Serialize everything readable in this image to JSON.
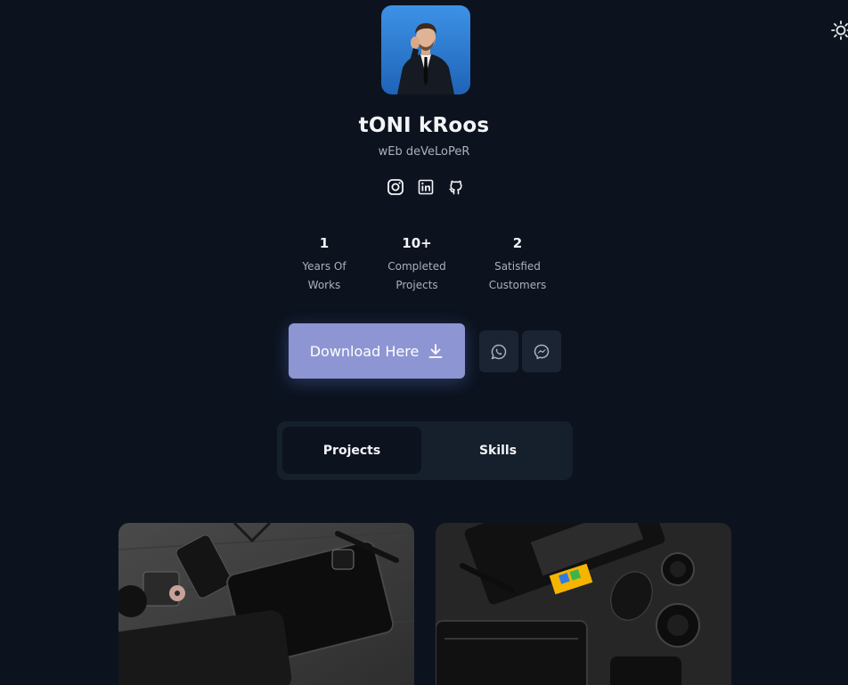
{
  "profile": {
    "name": "tONI kRoos",
    "role": "wEb deVeLoPeR"
  },
  "socials": [
    {
      "icon": "instagram-icon"
    },
    {
      "icon": "linkedin-icon"
    },
    {
      "icon": "github-icon"
    }
  ],
  "stats": [
    {
      "value": "1",
      "label_line1": "Years Of",
      "label_line2": "Works"
    },
    {
      "value": "10+",
      "label_line1": "Completed",
      "label_line2": "Projects"
    },
    {
      "value": "2",
      "label_line1": "Satisfied",
      "label_line2": "Customers"
    }
  ],
  "actions": {
    "download_label": "Download Here",
    "whatsapp_icon": "whatsapp-icon",
    "messenger_icon": "messenger-icon"
  },
  "tabs": [
    {
      "label": "Projects",
      "active": true
    },
    {
      "label": "Skills",
      "active": false
    }
  ],
  "colors": {
    "background": "#0c131f",
    "accent": "#8d96d3",
    "panel": "#161f2c",
    "muted_text": "#aab1bd"
  }
}
